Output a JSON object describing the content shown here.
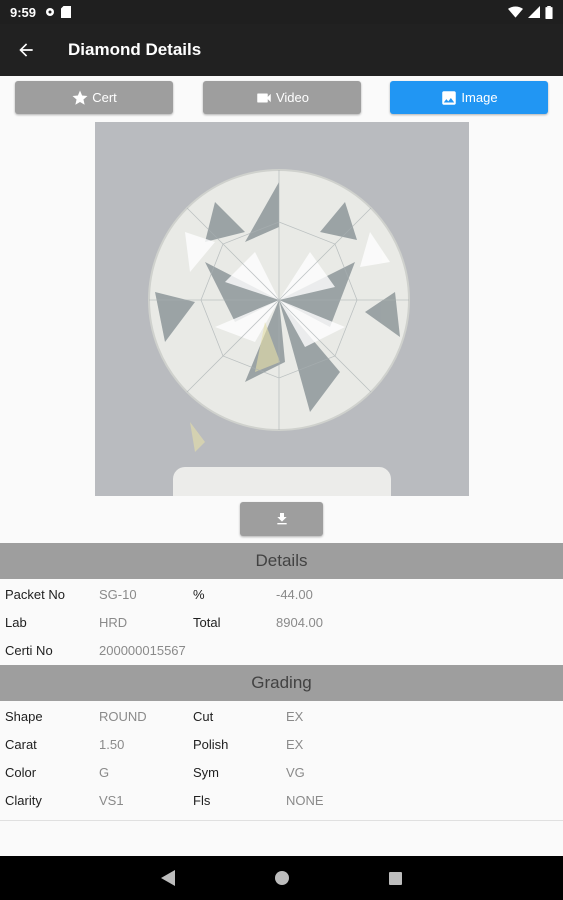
{
  "status_bar": {
    "time": "9:59"
  },
  "app_bar": {
    "title": "Diamond Details"
  },
  "tabs": [
    {
      "label": "Cert",
      "icon": "star-icon",
      "active": false
    },
    {
      "label": "Video",
      "icon": "videocam-icon",
      "active": false
    },
    {
      "label": "Image",
      "icon": "image-icon",
      "active": true
    }
  ],
  "colors": {
    "active_tab": "#2196f3",
    "inactive": "#9e9e9e",
    "app_bar": "#212121"
  },
  "details": {
    "header": "Details",
    "rows": [
      {
        "l1": "Packet No",
        "v1": "SG-10",
        "l2": "%",
        "v2": "-44.00"
      },
      {
        "l1": "Lab",
        "v1": "HRD",
        "l2": "Total",
        "v2": "8904.00"
      },
      {
        "l1": "Certi No",
        "v1": "200000015567"
      }
    ]
  },
  "grading": {
    "header": "Grading",
    "rows": [
      {
        "l1": "Shape",
        "v1": "ROUND",
        "l2": "Cut",
        "v2": "EX"
      },
      {
        "l1": "Carat",
        "v1": "1.50",
        "l2": "Polish",
        "v2": "EX"
      },
      {
        "l1": "Color",
        "v1": "G",
        "l2": "Sym",
        "v2": "VG"
      },
      {
        "l1": "Clarity",
        "v1": "VS1",
        "l2": "Fls",
        "v2": "NONE"
      }
    ]
  }
}
